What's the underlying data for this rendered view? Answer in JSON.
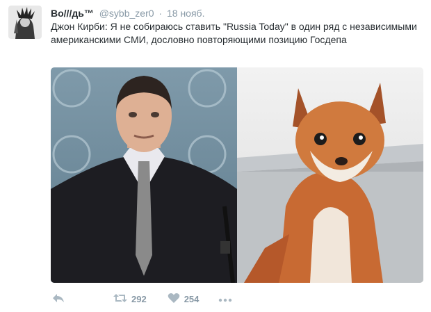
{
  "tweet": {
    "author_name": "Во///дь™",
    "handle": "@sybb_zer0",
    "separator": "·",
    "time": "18 нояб.",
    "text": "Джон Кирби: Я не собираюсь ставить \"Russia Today\" в один ряд с независимыми американскими СМИ, дословно повторяющими позицию Госдепа"
  },
  "actions": {
    "reply_icon": "reply-icon",
    "retweet_icon": "retweet-icon",
    "retweet_count": "292",
    "like_icon": "heart-icon",
    "like_count": "254",
    "more_icon": "more-dots-icon"
  },
  "colors": {
    "text": "#292f33",
    "muted": "#8899a6",
    "action_icon": "#aab8c2"
  }
}
